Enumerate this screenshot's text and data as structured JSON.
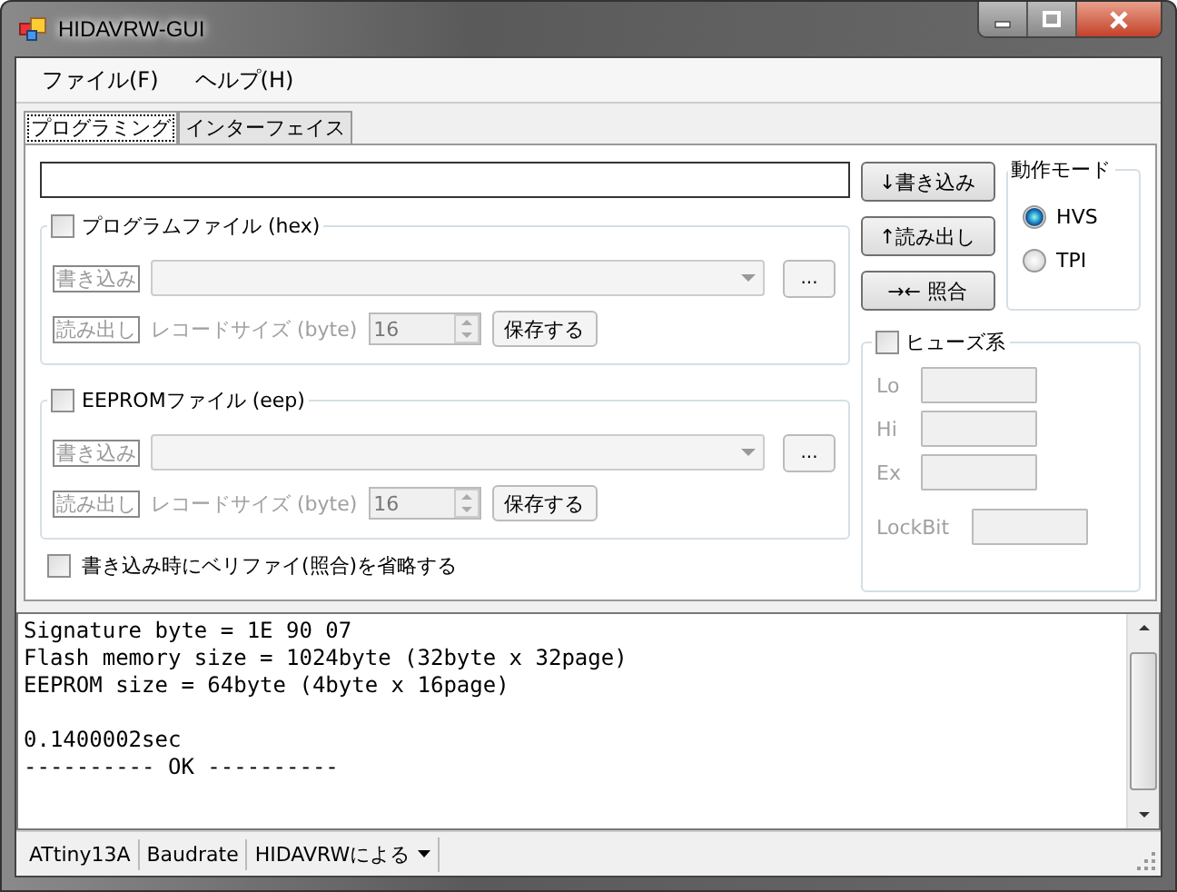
{
  "window": {
    "title": "HIDAVRW-GUI"
  },
  "menu": [
    {
      "label": "ファイル(F)"
    },
    {
      "label": "ヘルプ(H)"
    }
  ],
  "tabs": [
    {
      "label": "プログラミング",
      "selected": true
    },
    {
      "label": "インターフェイス",
      "selected": false
    }
  ],
  "actions": [
    {
      "label": "↓書き込み"
    },
    {
      "label": "↑読み出し"
    },
    {
      "label": "→← 照合"
    }
  ],
  "mode": {
    "title": "動作モード",
    "options": [
      {
        "label": "HVS",
        "selected": true
      },
      {
        "label": "TPI",
        "selected": false
      }
    ]
  },
  "file_groups": [
    {
      "title": "プログラムファイル (hex)",
      "checked": false,
      "write_label": "書き込み",
      "browse": "...",
      "read_label": "読み出し",
      "record_size_label": "レコードサイズ (byte)",
      "record_size": "16",
      "save": "保存する"
    },
    {
      "title": "EEPROMファイル (eep)",
      "checked": false,
      "write_label": "書き込み",
      "browse": "...",
      "read_label": "読み出し",
      "record_size_label": "レコードサイズ (byte)",
      "record_size": "16",
      "save": "保存する"
    }
  ],
  "verify_skip": {
    "label": "書き込み時にベリファイ(照合)を省略する",
    "checked": false
  },
  "fuses": {
    "title": "ヒューズ系",
    "checked": false,
    "fields": [
      {
        "label": "Lo"
      },
      {
        "label": "Hi"
      },
      {
        "label": "Ex"
      },
      {
        "label": "LockBit"
      }
    ]
  },
  "log": [
    [
      "Signature byte = 1E 90 07",
      "Flash memory size = 1024byte (32byte x 32page)",
      "EEPROM size = 64byte (4byte x 16page)"
    ],
    [
      "0.1400002sec",
      "---------- OK ----------"
    ]
  ],
  "status_bar": [
    {
      "label": "ATtiny13A",
      "kind": "label"
    },
    {
      "label": "Baudrate",
      "kind": "label"
    },
    {
      "label": "HIDAVRWによる",
      "kind": "dropdown"
    }
  ]
}
